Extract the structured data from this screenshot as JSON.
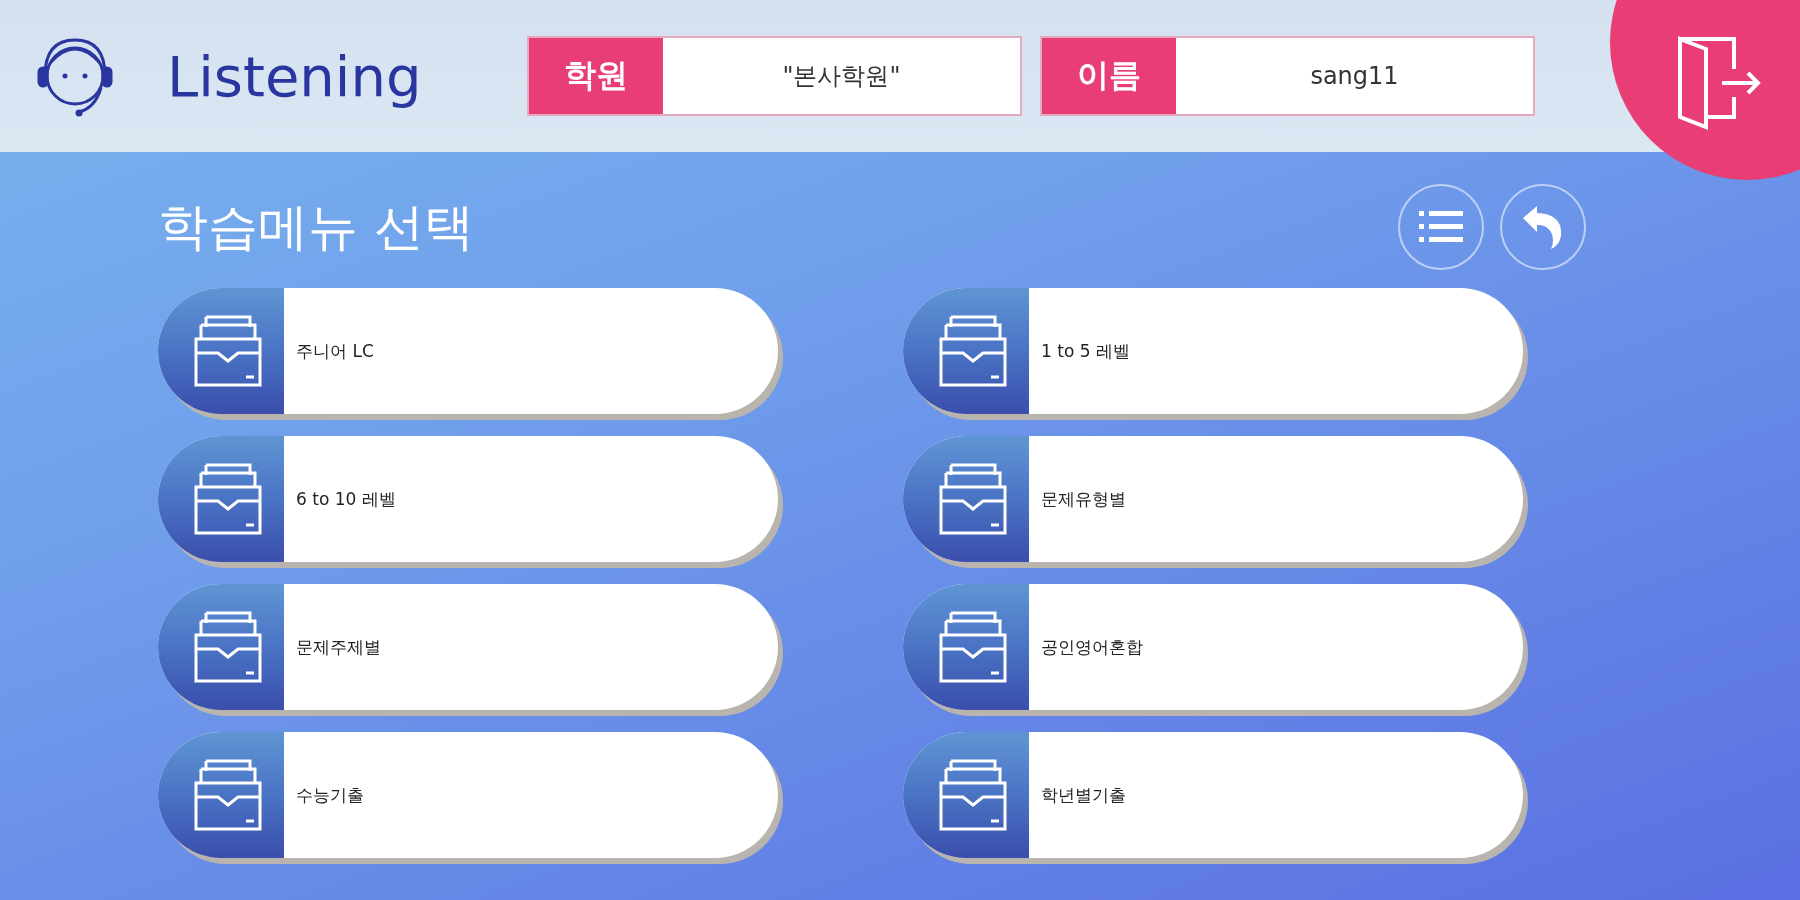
{
  "app": {
    "title": "Listening"
  },
  "fields": [
    {
      "label": "학원",
      "value": "\"본사학원\""
    },
    {
      "label": "이름",
      "value": "sang11"
    }
  ],
  "page_title": "학습메뉴 선택",
  "menu_items": [
    {
      "label": "주니어 LC"
    },
    {
      "label": "1 to 5 레벨"
    },
    {
      "label": "6 to 10 레벨"
    },
    {
      "label": "문제유형별"
    },
    {
      "label": "문제주제별"
    },
    {
      "label": "공인영어혼합"
    },
    {
      "label": "수능기출"
    },
    {
      "label": "학년별기출"
    }
  ]
}
